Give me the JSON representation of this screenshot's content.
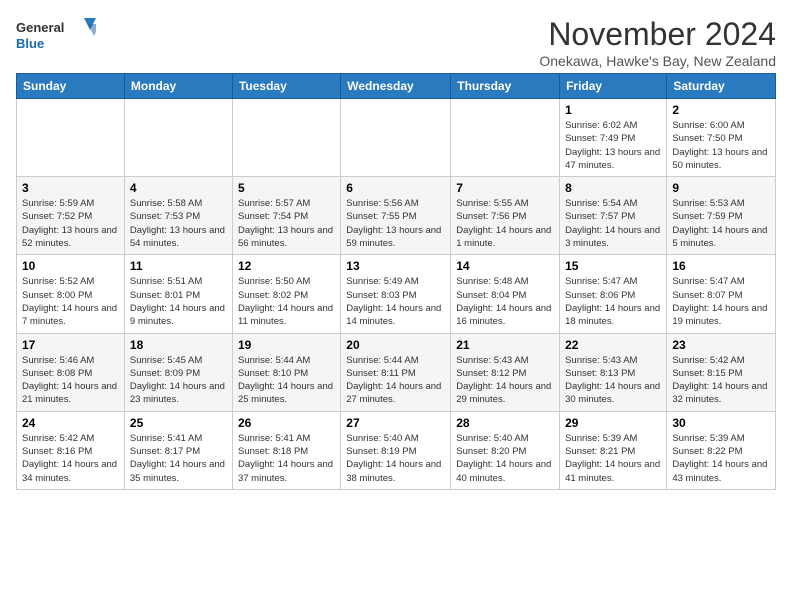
{
  "logo": {
    "line1": "General",
    "line2": "Blue"
  },
  "title": "November 2024",
  "location": "Onekawa, Hawke's Bay, New Zealand",
  "days_of_week": [
    "Sunday",
    "Monday",
    "Tuesday",
    "Wednesday",
    "Thursday",
    "Friday",
    "Saturday"
  ],
  "weeks": [
    [
      {
        "day": "",
        "detail": ""
      },
      {
        "day": "",
        "detail": ""
      },
      {
        "day": "",
        "detail": ""
      },
      {
        "day": "",
        "detail": ""
      },
      {
        "day": "",
        "detail": ""
      },
      {
        "day": "1",
        "detail": "Sunrise: 6:02 AM\nSunset: 7:49 PM\nDaylight: 13 hours and 47 minutes."
      },
      {
        "day": "2",
        "detail": "Sunrise: 6:00 AM\nSunset: 7:50 PM\nDaylight: 13 hours and 50 minutes."
      }
    ],
    [
      {
        "day": "3",
        "detail": "Sunrise: 5:59 AM\nSunset: 7:52 PM\nDaylight: 13 hours and 52 minutes."
      },
      {
        "day": "4",
        "detail": "Sunrise: 5:58 AM\nSunset: 7:53 PM\nDaylight: 13 hours and 54 minutes."
      },
      {
        "day": "5",
        "detail": "Sunrise: 5:57 AM\nSunset: 7:54 PM\nDaylight: 13 hours and 56 minutes."
      },
      {
        "day": "6",
        "detail": "Sunrise: 5:56 AM\nSunset: 7:55 PM\nDaylight: 13 hours and 59 minutes."
      },
      {
        "day": "7",
        "detail": "Sunrise: 5:55 AM\nSunset: 7:56 PM\nDaylight: 14 hours and 1 minute."
      },
      {
        "day": "8",
        "detail": "Sunrise: 5:54 AM\nSunset: 7:57 PM\nDaylight: 14 hours and 3 minutes."
      },
      {
        "day": "9",
        "detail": "Sunrise: 5:53 AM\nSunset: 7:59 PM\nDaylight: 14 hours and 5 minutes."
      }
    ],
    [
      {
        "day": "10",
        "detail": "Sunrise: 5:52 AM\nSunset: 8:00 PM\nDaylight: 14 hours and 7 minutes."
      },
      {
        "day": "11",
        "detail": "Sunrise: 5:51 AM\nSunset: 8:01 PM\nDaylight: 14 hours and 9 minutes."
      },
      {
        "day": "12",
        "detail": "Sunrise: 5:50 AM\nSunset: 8:02 PM\nDaylight: 14 hours and 11 minutes."
      },
      {
        "day": "13",
        "detail": "Sunrise: 5:49 AM\nSunset: 8:03 PM\nDaylight: 14 hours and 14 minutes."
      },
      {
        "day": "14",
        "detail": "Sunrise: 5:48 AM\nSunset: 8:04 PM\nDaylight: 14 hours and 16 minutes."
      },
      {
        "day": "15",
        "detail": "Sunrise: 5:47 AM\nSunset: 8:06 PM\nDaylight: 14 hours and 18 minutes."
      },
      {
        "day": "16",
        "detail": "Sunrise: 5:47 AM\nSunset: 8:07 PM\nDaylight: 14 hours and 19 minutes."
      }
    ],
    [
      {
        "day": "17",
        "detail": "Sunrise: 5:46 AM\nSunset: 8:08 PM\nDaylight: 14 hours and 21 minutes."
      },
      {
        "day": "18",
        "detail": "Sunrise: 5:45 AM\nSunset: 8:09 PM\nDaylight: 14 hours and 23 minutes."
      },
      {
        "day": "19",
        "detail": "Sunrise: 5:44 AM\nSunset: 8:10 PM\nDaylight: 14 hours and 25 minutes."
      },
      {
        "day": "20",
        "detail": "Sunrise: 5:44 AM\nSunset: 8:11 PM\nDaylight: 14 hours and 27 minutes."
      },
      {
        "day": "21",
        "detail": "Sunrise: 5:43 AM\nSunset: 8:12 PM\nDaylight: 14 hours and 29 minutes."
      },
      {
        "day": "22",
        "detail": "Sunrise: 5:43 AM\nSunset: 8:13 PM\nDaylight: 14 hours and 30 minutes."
      },
      {
        "day": "23",
        "detail": "Sunrise: 5:42 AM\nSunset: 8:15 PM\nDaylight: 14 hours and 32 minutes."
      }
    ],
    [
      {
        "day": "24",
        "detail": "Sunrise: 5:42 AM\nSunset: 8:16 PM\nDaylight: 14 hours and 34 minutes."
      },
      {
        "day": "25",
        "detail": "Sunrise: 5:41 AM\nSunset: 8:17 PM\nDaylight: 14 hours and 35 minutes."
      },
      {
        "day": "26",
        "detail": "Sunrise: 5:41 AM\nSunset: 8:18 PM\nDaylight: 14 hours and 37 minutes."
      },
      {
        "day": "27",
        "detail": "Sunrise: 5:40 AM\nSunset: 8:19 PM\nDaylight: 14 hours and 38 minutes."
      },
      {
        "day": "28",
        "detail": "Sunrise: 5:40 AM\nSunset: 8:20 PM\nDaylight: 14 hours and 40 minutes."
      },
      {
        "day": "29",
        "detail": "Sunrise: 5:39 AM\nSunset: 8:21 PM\nDaylight: 14 hours and 41 minutes."
      },
      {
        "day": "30",
        "detail": "Sunrise: 5:39 AM\nSunset: 8:22 PM\nDaylight: 14 hours and 43 minutes."
      }
    ]
  ]
}
